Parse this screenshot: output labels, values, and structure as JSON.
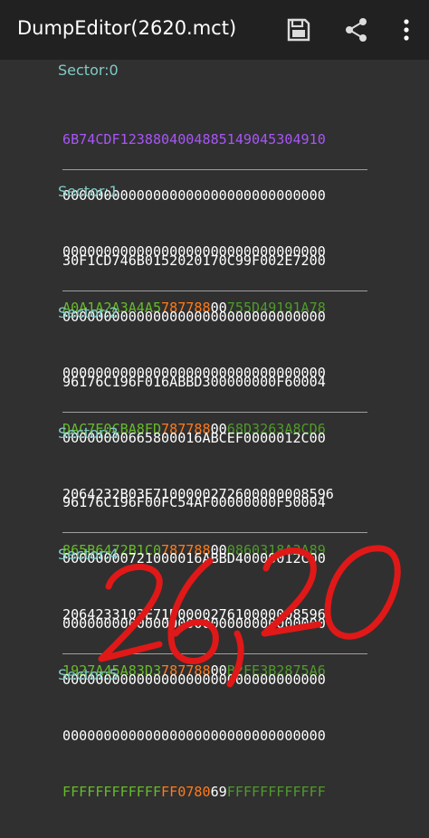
{
  "appbar": {
    "title": "Dump Editor (2620.mct)",
    "icons": [
      "save-icon",
      "share-icon",
      "more-vert-icon"
    ]
  },
  "sectors": [
    {
      "label": "Sector: 0",
      "uid_line": "6B74CDF123880400488514904530491​0",
      "lines": [
        "00000000000000000000000000000000",
        "00000000000000000000000000000000"
      ],
      "trailer": {
        "key_a": "A0A1A2A3A4A5",
        "access_bits": "787788",
        "gpb": "00",
        "key_b": "755D49191A78"
      }
    },
    {
      "label": "Sector: 1",
      "lines": [
        "30F1CD746B0152020170C99F002E7200",
        "00000000000000000000000000000000",
        "00000000000000000000000000000000"
      ],
      "trailer": {
        "key_a": "DAC7E0CBA8FD",
        "access_bits": "787788",
        "gpb": "00",
        "key_b": "68D3263A8CD6"
      }
    },
    {
      "label": "Sector: 2",
      "lines": [
        "96176C196F016ABBD300000000F60004",
        "0000000066580001 6ABCEF0000012C00",
        "2064232B03E7100000272600000008596"
      ],
      "trailer": {
        "key_a": "865B6472B1C0",
        "access_bits": "787788",
        "gpb": "00",
        "key_b": "0860318A3A89"
      }
    },
    {
      "label": "Sector: 3",
      "lines": [
        "96176C196F00FC54AF00000000F50004",
        "00000000721000016ABBD40000012C00",
        "2064233103E71D0000276100000085 96"
      ],
      "trailer": {
        "key_a": "1927A45A83D3",
        "access_bits": "787788",
        "gpb": "00",
        "key_b": "B2FE3B2875A6"
      }
    },
    {
      "label": "Sector: 4",
      "lines": [
        "00000000000000000000000000000000",
        "00000000000000000000000000000000",
        "00000000000000000000000000000000"
      ],
      "trailer": {
        "key_a": "FFFFFFFFFFFF",
        "access_bits": "FF0780",
        "gpb": "69",
        "key_b": "FFFFFFFFFFFF"
      }
    },
    {
      "label": "Sector: 5"
    }
  ],
  "overlay": {
    "handwriting": "26,20",
    "color": "#e01818"
  },
  "colors": {
    "appbar": "#212121",
    "background": "#303030",
    "sector_label": "#80cbc4",
    "uid": "#a855f7",
    "key_a": "#66bb2a",
    "access_bits": "#ff7a1a",
    "key_b": "#4f9a2a"
  }
}
